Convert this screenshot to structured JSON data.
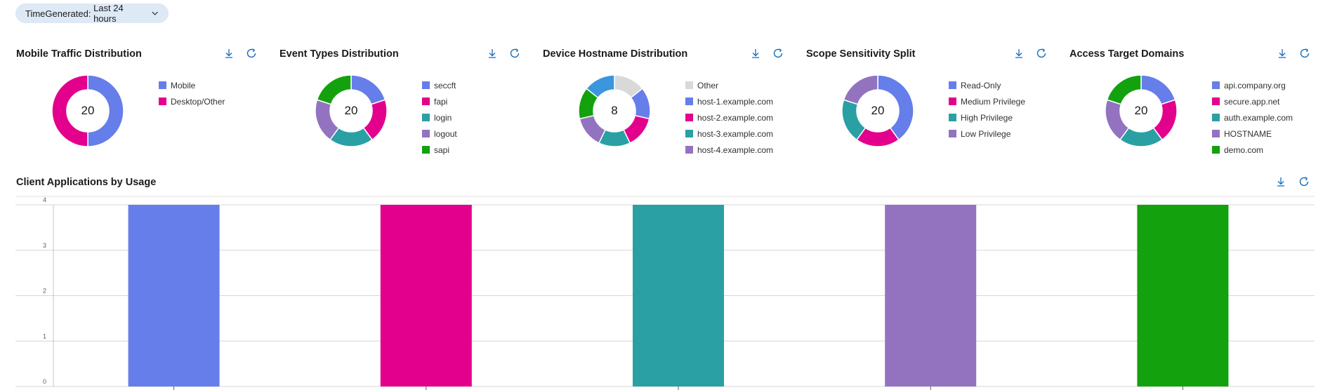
{
  "filter": {
    "label": "TimeGenerated: ",
    "value": "Last 24 hours"
  },
  "toolbar": {
    "download_icon": "download-icon",
    "refresh_icon": "refresh-icon"
  },
  "panels": [
    {
      "title": "Mobile Traffic Distribution",
      "center": "20",
      "legend": [
        {
          "label": "Mobile",
          "color": "#667eea",
          "value": 10
        },
        {
          "label": "Desktop/Other",
          "color": "#e3008c",
          "value": 10
        }
      ]
    },
    {
      "title": "Event Types Distribution",
      "center": "20",
      "legend": [
        {
          "label": "seccft",
          "color": "#667eea",
          "value": 4
        },
        {
          "label": "fapi",
          "color": "#e3008c",
          "value": 4
        },
        {
          "label": "login",
          "color": "#2aa0a4",
          "value": 4
        },
        {
          "label": "logout",
          "color": "#9373c0",
          "value": 4
        },
        {
          "label": "sapi",
          "color": "#13a10e",
          "value": 4
        }
      ]
    },
    {
      "title": "Device Hostname Distribution",
      "center": "8",
      "legend": [
        {
          "label": "Other",
          "color": "#d9d9d9",
          "value": 1
        },
        {
          "label": "host-1.example.com",
          "color": "#667eea",
          "value": 1
        },
        {
          "label": "host-2.example.com",
          "color": "#e3008c",
          "value": 1
        },
        {
          "label": "host-3.example.com",
          "color": "#2aa0a4",
          "value": 1
        },
        {
          "label": "host-4.example.com",
          "color": "#9373c0",
          "value": 1
        }
      ],
      "extra_slices": [
        {
          "color": "#13a10e",
          "value": 1
        },
        {
          "color": "#3a96dd",
          "value": 1
        }
      ]
    },
    {
      "title": "Scope Sensitivity Split",
      "center": "20",
      "legend": [
        {
          "label": "Read-Only",
          "color": "#667eea",
          "value": 8
        },
        {
          "label": "Medium Privilege",
          "color": "#e3008c",
          "value": 4
        },
        {
          "label": "High Privilege",
          "color": "#2aa0a4",
          "value": 4
        },
        {
          "label": "Low Privilege",
          "color": "#9373c0",
          "value": 4
        }
      ]
    },
    {
      "title": "Access Target Domains",
      "center": "20",
      "legend": [
        {
          "label": "api.company.org",
          "color": "#667eea",
          "value": 4
        },
        {
          "label": "secure.app.net",
          "color": "#e3008c",
          "value": 4
        },
        {
          "label": "auth.example.com",
          "color": "#2aa0a4",
          "value": 4
        },
        {
          "label": "HOSTNAME",
          "color": "#9373c0",
          "value": 4
        },
        {
          "label": "demo.com",
          "color": "#13a10e",
          "value": 4
        }
      ]
    }
  ],
  "bar": {
    "title": "Client Applications by Usage"
  },
  "chart_data": {
    "type": "bar",
    "title": "Client Applications by Usage",
    "categories": [
      "",
      "",
      "",
      "",
      ""
    ],
    "values": [
      4,
      4,
      4,
      4,
      4
    ],
    "colors": [
      "#667eea",
      "#e3008c",
      "#2aa0a4",
      "#9373c0",
      "#13a10e"
    ],
    "ylim": [
      0,
      4
    ],
    "yticks": [
      "0",
      "1",
      "2",
      "3",
      "4"
    ],
    "grid": true
  }
}
